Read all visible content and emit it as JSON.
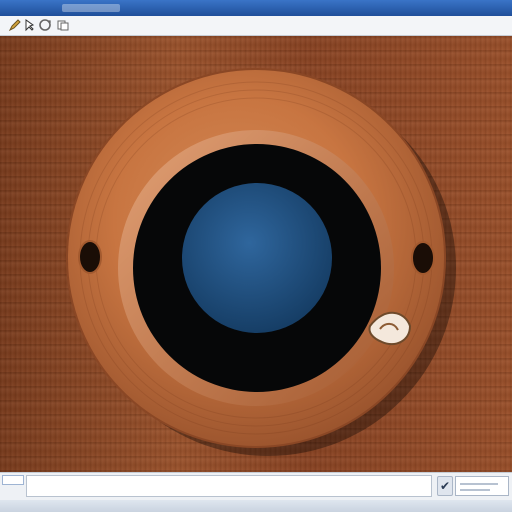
{
  "window": {
    "title": ""
  },
  "toolbar": {
    "buttons": [
      {
        "icon": "pencil-icon"
      },
      {
        "icon": "cursor-icon"
      },
      {
        "icon": "refresh-icon"
      },
      {
        "icon": "copy-icon"
      }
    ]
  },
  "status": {
    "confirm_label": "✔"
  },
  "colors": {
    "titlebar": "#2f66b8",
    "toolbar": "#f3f5f8",
    "wood": "#9b522b",
    "ring": "#c87541",
    "lens_inner": "#1d4f80",
    "lens_dark": "#060708"
  }
}
